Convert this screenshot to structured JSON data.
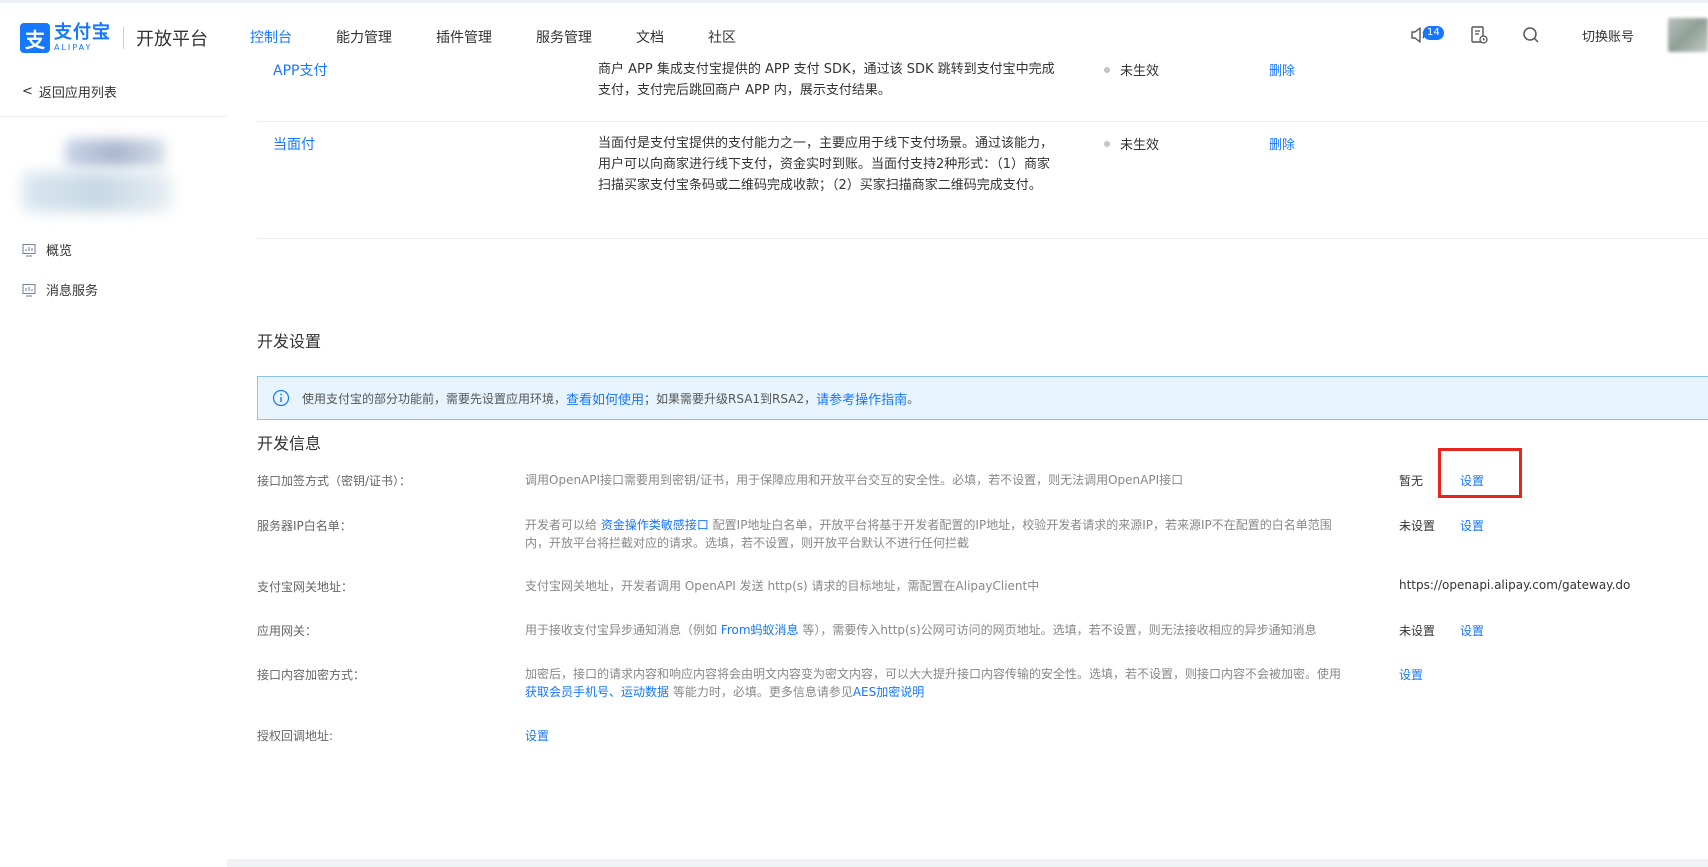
{
  "brand": {
    "logo_char": "支",
    "name_cn": "支付宝",
    "name_en": "ALIPAY",
    "platform": "开放平台"
  },
  "nav": {
    "items": [
      {
        "label": "控制台",
        "active": true
      },
      {
        "label": "能力管理"
      },
      {
        "label": "插件管理"
      },
      {
        "label": "服务管理"
      },
      {
        "label": "文档"
      },
      {
        "label": "社区"
      }
    ]
  },
  "topright": {
    "notification_count": "14",
    "switch_account": "切换账号",
    "accent": "#1677ff"
  },
  "sidebar": {
    "back_label": "返回应用列表",
    "items": [
      {
        "label": "概览",
        "icon": "dashboard-icon"
      },
      {
        "label": "消息服务",
        "icon": "message-icon"
      }
    ]
  },
  "products": [
    {
      "name": "APP支付",
      "description": "商户 APP 集成支付宝提供的 APP 支付 SDK，通过该 SDK 跳转到支付宝中完成支付，支付完后跳回商户 APP 内，展示支付结果。",
      "status": "未生效",
      "action": "删除"
    },
    {
      "name": "当面付",
      "description": "当面付是支付宝提供的支付能力之一，主要应用于线下支付场景。通过该能力，用户可以向商家进行线下支付，资金实时到账。当面付支持2种形式：（1）商家扫描买家支付宝条码或二维码完成收款；（2）买家扫描商家二维码完成支付。",
      "status": "未生效",
      "action": "删除"
    }
  ],
  "dev_settings": {
    "title": "开发设置",
    "alert": {
      "text1": "使用支付宝的部分功能前，需要先设置应用环境，",
      "link1": "查看如何使用",
      "text2": "；如果需要升级RSA1到RSA2，",
      "link2": "请参考操作指南",
      "text3": "。"
    }
  },
  "dev_info": {
    "title": "开发信息",
    "rows": [
      {
        "label": "接口加签方式（密钥/证书）：",
        "desc": "调用OpenAPI接口需要用到密钥/证书，用于保障应用和开放平台交互的安全性。必填，若不设置，则无法调用OpenAPI接口",
        "value": "暂无",
        "action": "设置"
      },
      {
        "label": "服务器IP白名单：",
        "desc_pre": "开发者可以给 ",
        "desc_link": "资金操作类敏感接口",
        "desc_post": " 配置IP地址白名单，开放平台将基于开发者配置的IP地址，校验开发者请求的来源IP，若来源IP不在配置的白名单范围内，开放平台将拦截对应的请求。选填，若不设置，则开放平台默认不进行任何拦截",
        "value": "未设置",
        "action": "设置"
      },
      {
        "label": "支付宝网关地址：",
        "desc": "支付宝网关地址，开发者调用 OpenAPI 发送 http(s) 请求的目标地址，需配置在AlipayClient中",
        "value": "https://openapi.alipay.com/gateway.do"
      },
      {
        "label": "应用网关：",
        "desc_pre": "用于接收支付宝异步通知消息（例如 ",
        "desc_link": "From蚂蚁消息",
        "desc_post": " 等），需要传入http(s)公网可访问的网页地址。选填，若不设置，则无法接收相应的异步通知消息",
        "value": "未设置",
        "action": "设置"
      },
      {
        "label": "接口内容加密方式：",
        "desc_pre": "加密后，接口的请求内容和响应内容将会由明文内容变为密文内容，可以大大提升接口内容传输的安全性。选填，若不设置，则接口内容不会被加密。使用 ",
        "desc_link": "获取会员手机号、运动数据",
        "desc_mid": " 等能力时，必填。更多信息请参见",
        "desc_link2": "AES加密说明",
        "action": "设置"
      },
      {
        "label": "授权回调地址:",
        "action": "设置"
      }
    ]
  }
}
